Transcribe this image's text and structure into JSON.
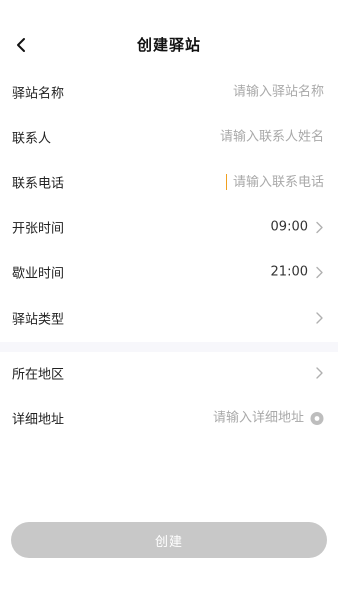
{
  "header": {
    "title": "创建驿站"
  },
  "form": {
    "station_name": {
      "label": "驿站名称",
      "placeholder": "请输入驿站名称"
    },
    "contact": {
      "label": "联系人",
      "placeholder": "请输入联系人姓名"
    },
    "phone": {
      "label": "联系电话",
      "placeholder": "请输入联系电话"
    },
    "open_time": {
      "label": "开张时间",
      "value": "09:00"
    },
    "close_time": {
      "label": "歇业时间",
      "value": "21:00"
    },
    "station_type": {
      "label": "驿站类型",
      "value": ""
    },
    "region": {
      "label": "所在地区",
      "value": ""
    },
    "address": {
      "label": "详细地址",
      "placeholder": "请输入详细地址"
    }
  },
  "actions": {
    "create_label": "创建"
  },
  "colors": {
    "button_disabled": "#c8c8c8",
    "caret": "#f0a020",
    "placeholder": "#a9a9a9",
    "section_gap": "#f7f7fb"
  },
  "icons": {
    "back": "chevron-left-icon",
    "disclosure": "chevron-right-icon",
    "location": "location-pin-icon"
  }
}
